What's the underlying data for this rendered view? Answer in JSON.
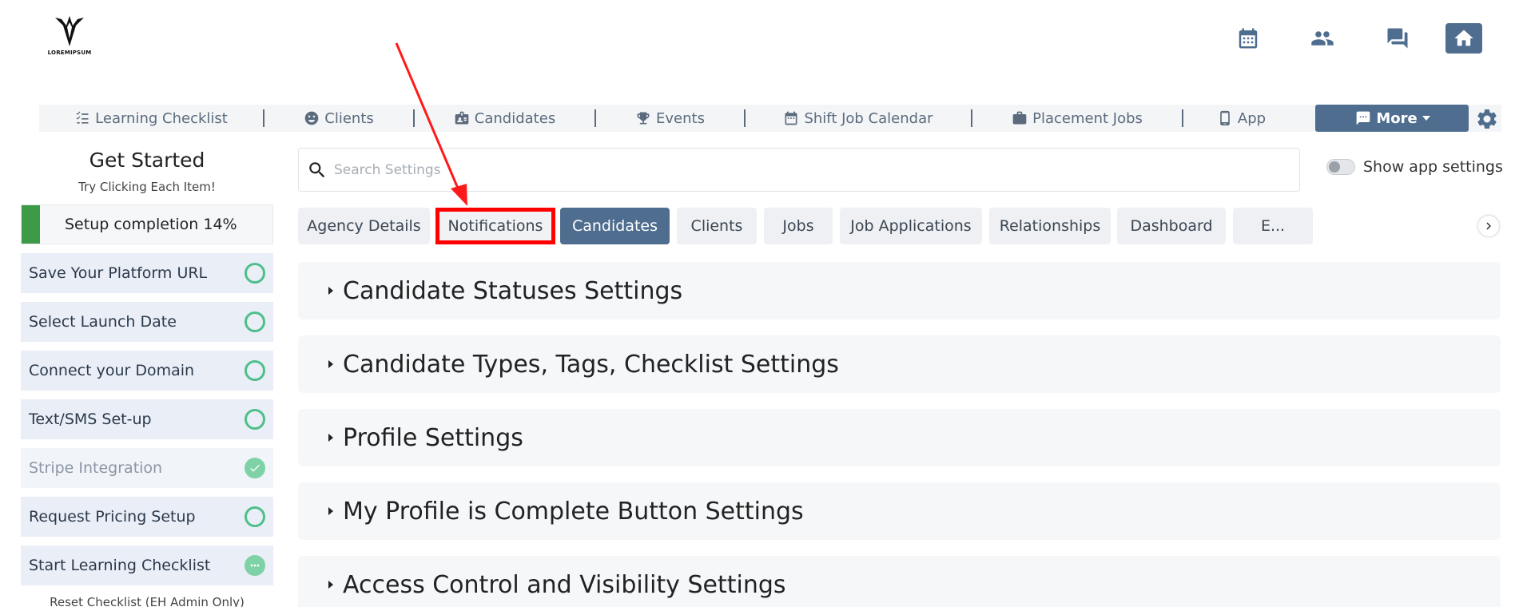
{
  "logo": {
    "brand": "LOREMIPSUM",
    "sub": ""
  },
  "nav": {
    "items": [
      {
        "label": "Learning Checklist",
        "icon": "checklist-icon"
      },
      {
        "label": "Clients",
        "icon": "clients-icon"
      },
      {
        "label": "Candidates",
        "icon": "id-badge-icon"
      },
      {
        "label": "Events",
        "icon": "trophy-icon"
      },
      {
        "label": "Shift Job Calendar",
        "icon": "calendar-icon"
      },
      {
        "label": "Placement Jobs",
        "icon": "briefcase-icon"
      },
      {
        "label": "App",
        "icon": "mobile-icon"
      }
    ],
    "more_label": "More"
  },
  "sidebar": {
    "title": "Get Started",
    "subtitle": "Try Clicking Each Item!",
    "progress_label": "Setup completion 14%",
    "progress_percent": 14,
    "items": [
      {
        "label": "Save Your Platform URL",
        "status": "open"
      },
      {
        "label": "Select Launch Date",
        "status": "open"
      },
      {
        "label": "Connect your Domain",
        "status": "open"
      },
      {
        "label": "Text/SMS Set-up",
        "status": "open"
      },
      {
        "label": "Stripe Integration",
        "status": "done"
      },
      {
        "label": "Request Pricing Setup",
        "status": "open"
      },
      {
        "label": "Start Learning Checklist",
        "status": "in-progress"
      }
    ],
    "reset_label": "Reset Checklist (EH Admin Only)"
  },
  "search": {
    "placeholder": "Search Settings",
    "value": ""
  },
  "toggle": {
    "label": "Show app settings",
    "on": false
  },
  "tabs": [
    {
      "label": "Agency Details",
      "state": "normal"
    },
    {
      "label": "Notifications",
      "state": "highlight"
    },
    {
      "label": "Candidates",
      "state": "active"
    },
    {
      "label": "Clients",
      "state": "normal"
    },
    {
      "label": "Jobs",
      "state": "normal"
    },
    {
      "label": "Job Applications",
      "state": "normal"
    },
    {
      "label": "Relationships",
      "state": "normal"
    },
    {
      "label": "Dashboard",
      "state": "normal"
    },
    {
      "label": "E...",
      "state": "normal"
    }
  ],
  "sections": [
    {
      "title": "Candidate Statuses Settings"
    },
    {
      "title": "Candidate Types, Tags, Checklist Settings"
    },
    {
      "title": "Profile Settings"
    },
    {
      "title": "My Profile is Complete Button Settings"
    },
    {
      "title": "Access Control and Visibility Settings"
    }
  ],
  "colors": {
    "accent": "#4f6d8f",
    "success": "#3d9a47",
    "highlight": "#ff0000"
  }
}
